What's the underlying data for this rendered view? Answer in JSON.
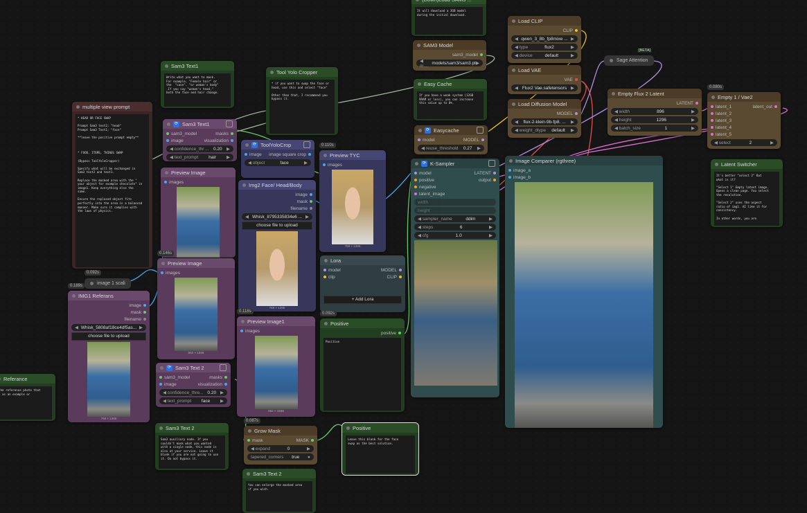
{
  "colors": {
    "purple": "#5b3b5c",
    "green": "#213f20",
    "brown": "#5a4a32",
    "blue": "#36375a",
    "teal": "#2f4d4c",
    "maroon": "#3a2626",
    "slate": "#2f3e43"
  },
  "pills": [
    {
      "id": "sage",
      "title": "Sage Attention",
      "badge": "[BETA]"
    },
    {
      "id": "scale",
      "title": "image 1 scali",
      "timing": "0.092s"
    }
  ],
  "nodes": [
    {
      "id": "dlsam",
      "title": "(Down)Load SAM3 ...",
      "color": "green",
      "text": "It will download a 3GB model\nduring the initial download."
    },
    {
      "id": "loadclip",
      "title": "Load CLIP",
      "color": "brown",
      "slots": [
        [
          "",
          "CLIP",
          "#f0c020"
        ]
      ],
      "widgets": [
        {
          "l": "",
          "v": "qwen_3_8b_fp8mixe ..."
        },
        {
          "l": "type",
          "v": "flux2"
        },
        {
          "l": "device",
          "v": "default"
        }
      ]
    },
    {
      "id": "sam3model",
      "title": "SAM3 Model",
      "color": "brown",
      "slots": [
        [
          "",
          "sam3_model",
          "#6c6"
        ]
      ],
      "widgets": [
        {
          "l": "m...",
          "v": "models/sam3/sam3.pt"
        }
      ]
    },
    {
      "id": "loadvae",
      "title": "Load VAE",
      "color": "brown",
      "slots": [
        [
          "",
          "VAE",
          "#e05050"
        ]
      ],
      "widgets": [
        {
          "l": "",
          "v": "Flux2 Vae.safetensors"
        }
      ]
    },
    {
      "id": "easynote",
      "title": "Easy Cache",
      "color": "green",
      "text": "If you have a weak system (12GB\nVRAM or less), you can increase\nthis value up to 0%."
    },
    {
      "id": "loaddiff",
      "title": "Load Diffusion Model",
      "color": "brown",
      "slots": [
        [
          "",
          "MODEL",
          "#b090e0"
        ]
      ],
      "widgets": [
        {
          "l": "",
          "v": "flux-2-klein-9b-fp8. ..."
        },
        {
          "l": "weight_dtype",
          "v": "default"
        }
      ]
    },
    {
      "id": "emptyflux",
      "title": "Empty Flux 2 Latent",
      "color": "brown",
      "slots": [
        [
          "",
          "LATENT",
          "#e070d0"
        ]
      ],
      "widgets": [
        {
          "l": "width",
          "v": "896"
        },
        {
          "l": "height",
          "v": "1296"
        },
        {
          "l": "batch_size",
          "v": "1"
        }
      ]
    },
    {
      "id": "empty1",
      "title": "Empty 1 / Vae2",
      "color": "brown",
      "timing": "0.080s",
      "slots": [
        [
          "latent_1",
          "latent_out",
          "#e070d0"
        ],
        [
          "latent_2",
          "",
          "#e070d0"
        ],
        [
          "latent_3",
          "",
          "#e070d0"
        ],
        [
          "latent_4",
          "",
          "#e070d0"
        ],
        [
          "latent_5",
          "",
          "#e070d0"
        ]
      ],
      "widgets": [
        {
          "l": "select",
          "v": "2"
        }
      ]
    },
    {
      "id": "switcher",
      "title": "Latent Switcher",
      "color": "green",
      "text": "It's better \"select 2\" But\nwhat is it?\n\n\"Select 1\" Empty latent image.\nOpens a clean page. You select\nthe resolution.\n\n\"Select 2\" uses the aspect\nratio of img1. AI like it for\nconsistency.\n\nIn other words, you are"
    },
    {
      "id": "sam3note1",
      "title": "Sam3 Text1",
      "color": "green",
      "text": "Write what you want to mask.\nFor example, \"Female hair\" or\nthe  \"case\", \"or woman's body\"\n.If you say \"woman's head,\"\nboth the face and hair change."
    },
    {
      "id": "yolonote",
      "title": "Tool Yolo Cropper",
      "color": "green",
      "text": "* if you want to swap the face or\nhead, use this and select \"face\"\n\nOther than that, I recommend you\nbypass it."
    },
    {
      "id": "mvp",
      "title": "multiple view prompt",
      "color": "maroon",
      "text": "* HEAD OR FACE SWAP\n\nPrompt Sam3 text2; \"head\"\nPrompt Sam3 Text1; \"face\"\n\n**leave the positive prompt empty**\n\n\n\n* FOOD, ITEMS, THINGS SWAP\n\n(Bypass ToolYoloCropper)\n\nSpecify what will be exchanged in\nSam3 text2 and text1.\n\nReplace the masked area with the \"\nyour object for example chocolate\" in\nimage1. Keep everything else the\nsame.\n\nEnsure the replaced object fits\nperfectly into the area in a balanced\nmanner. Make sure it complies with\nthe laws of physics."
    },
    {
      "id": "sam3t1",
      "title": "Sam3 Text1",
      "color": "purple",
      "app": true,
      "slots": [
        [
          "sam3_model",
          "masks",
          "#6c6"
        ],
        [
          "image",
          "visualization",
          "#4aa8f0"
        ]
      ],
      "widgets": [
        {
          "l": "confidence_thr ...",
          "v": "0.20"
        },
        {
          "l": "text_prompt",
          "v": "hair"
        }
      ]
    },
    {
      "id": "yolocrop",
      "title": "ToolYoloCrop",
      "color": "blue",
      "app": true,
      "slots": [
        [
          "image",
          "image square crop",
          "#4aa8f0"
        ]
      ],
      "widgets": [
        {
          "l": "object",
          "v": "face"
        }
      ]
    },
    {
      "id": "prev1",
      "title": "Preview Image",
      "color": "purple",
      "slots": [
        [
          "images",
          "",
          "#4aa8f0"
        ]
      ],
      "image": {
        "kind": "",
        "cap": ""
      }
    },
    {
      "id": "img2",
      "title": "Img2 Face/ Head/Body",
      "color": "blue",
      "slots": [
        [
          "",
          "image",
          "#4aa8f0"
        ],
        [
          "",
          "mask",
          "#6c6"
        ],
        [
          "",
          "filename",
          "#888"
        ]
      ],
      "widgets": [
        {
          "l": "",
          "v": "Whisk_8795335834e6 ..."
        }
      ],
      "button": "choose file to upload",
      "image": {
        "kind": "face",
        "cap": "768 × 1365"
      }
    },
    {
      "id": "tyc",
      "title": "Preview TYC",
      "color": "blue",
      "timing": "0.110s",
      "slots": [
        [
          "images",
          "",
          "#4aa8f0"
        ]
      ],
      "image": {
        "kind": "face",
        "cap": "768 × 1365"
      }
    },
    {
      "id": "easycache",
      "title": "Easycache",
      "color": "brown",
      "app": true,
      "slots": [
        [
          "model",
          "MODEL",
          "#b090e0"
        ]
      ],
      "widgets": [
        {
          "l": "reuse_threshold",
          "v": "0.27"
        }
      ]
    },
    {
      "id": "ksampler",
      "title": "K-Sampler",
      "color": "teal",
      "app": true,
      "slots": [
        [
          "model",
          "LATENT",
          "#b090e0"
        ],
        [
          "positive",
          "output",
          "#f0a030"
        ],
        [
          "negative",
          "",
          "#f0a030"
        ],
        [
          "latent_image",
          "",
          "#e070d0"
        ]
      ],
      "widgets": [
        {
          "l": "width",
          "v": "",
          "dis": true
        },
        {
          "l": "height",
          "v": "",
          "dis": true
        },
        {
          "l": "sampler_name",
          "v": "ddim"
        },
        {
          "l": "steps",
          "v": "6"
        },
        {
          "l": "cfg",
          "v": "1.0"
        }
      ],
      "image": {
        "kind": "noise",
        "cap": ""
      }
    },
    {
      "id": "comparer",
      "title": "Image Comparer (rgthree)",
      "color": "teal",
      "slots": [
        [
          "image_a",
          "",
          "#4aa8f0"
        ],
        [
          "image_b",
          "",
          "#4aa8f0"
        ]
      ],
      "image": {
        "kind": "",
        "cap": ""
      }
    },
    {
      "id": "prev2",
      "title": "Preview Image",
      "color": "purple",
      "timing": "0.146s",
      "slots": [
        [
          "images",
          "",
          "#4aa8f0"
        ]
      ],
      "image": {
        "kind": "",
        "cap": "882 × 1568"
      }
    },
    {
      "id": "img1",
      "title": "IMG1 Referans",
      "color": "purple",
      "timing": "0.189s",
      "slots": [
        [
          "",
          "image",
          "#4aa8f0"
        ],
        [
          "",
          "mask",
          "#6c6"
        ],
        [
          "",
          "filename",
          "#888"
        ]
      ],
      "widgets": [
        {
          "l": "",
          "v": "Whisk_5808af18ce4df5as..."
        }
      ],
      "button": "choose file to upload",
      "image": {
        "kind": "",
        "cap": "768 × 1365"
      }
    },
    {
      "id": "lora",
      "title": "Lora",
      "color": "slate",
      "slots": [
        [
          "model",
          "MODEL",
          "#b090e0"
        ],
        [
          "clip",
          "CLIP",
          "#f0c020"
        ]
      ],
      "button": "+ Add Lora"
    },
    {
      "id": "sam3t2",
      "title": "Sam3 Text 2",
      "color": "purple",
      "app": true,
      "slots": [
        [
          "sam3_model",
          "masks",
          "#6c6"
        ],
        [
          "image",
          "visualization",
          "#4aa8f0"
        ]
      ],
      "widgets": [
        {
          "l": "confidence_thre...",
          "v": "0.20"
        },
        {
          "l": "text_prompt",
          "v": "face"
        }
      ]
    },
    {
      "id": "prev3",
      "title": "Preview Image1",
      "color": "purple",
      "timing": "0.118s",
      "slots": [
        [
          "images",
          "",
          "#4aa8f0"
        ]
      ],
      "image": {
        "kind": "",
        "cap": "882 × 1568"
      }
    },
    {
      "id": "positive",
      "title": "Positive",
      "color": "green",
      "timing": "0.092s",
      "slots": [
        [
          "",
          "positive",
          "#6c6"
        ]
      ],
      "text": "Positive"
    },
    {
      "id": "refnote",
      "title": "Referance",
      "color": "green",
      "text": "the reference photo that\nk as an example or\n."
    },
    {
      "id": "sam3note2",
      "title": "Sam3 Text 2",
      "color": "green",
      "text": "Sam3 auxiliary node. If you\ncouldn't mask what you wanted\nwith a single node, this node is\nalso at your service. Leave it\nblank if you are not going to use\nit. Do not bypass it."
    },
    {
      "id": "grow",
      "title": "Grow Mask",
      "color": "brown",
      "timing": "0.087s",
      "slots": [
        [
          "mask",
          "MASK",
          "#6c6"
        ]
      ],
      "widgets": [
        {
          "l": "expand",
          "v": "0"
        },
        {
          "l": "tapered_corners",
          "v": "true",
          "toggle": true
        }
      ]
    },
    {
      "id": "posnote",
      "title": "Positive",
      "color": "green",
      "selected": true,
      "text": "Leave this blank for the face\nswap as the best solution."
    },
    {
      "id": "sam3note3",
      "title": "Sam3 Text 2",
      "color": "green",
      "text": "You can enlarge the masked area\nif you wish."
    }
  ]
}
